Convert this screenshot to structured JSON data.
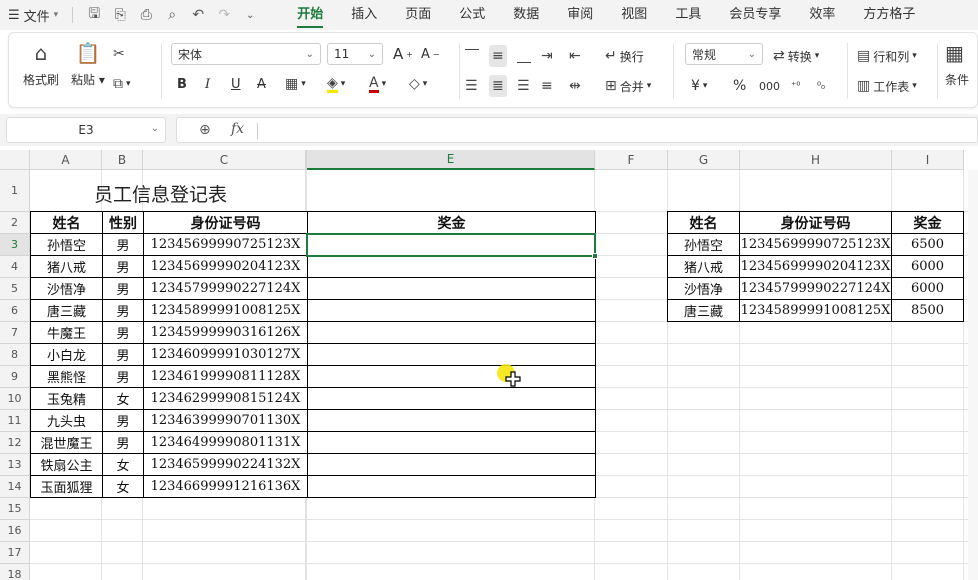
{
  "menubar": {
    "file_label": "文件",
    "tabs": [
      "开始",
      "插入",
      "页面",
      "公式",
      "数据",
      "审阅",
      "视图",
      "工具",
      "会员专享",
      "效率",
      "方方格子"
    ],
    "active_tab": 0
  },
  "ribbon": {
    "format_painter": "格式刷",
    "paste": "粘贴",
    "font_name": "宋体",
    "font_size": "11",
    "wrap": "换行",
    "merge": "合并",
    "number_format": "常规",
    "convert": "转换",
    "row_col": "行和列",
    "worksheet": "工作表",
    "conditional": "条件",
    "currency_symbol": "¥",
    "percent_symbol": "%",
    "bold": "B",
    "italic": "I",
    "underline": "U",
    "font_grow": "A",
    "font_shrink": "A"
  },
  "formula_bar": {
    "cell_ref": "E3",
    "fx_label": "fx",
    "formula": ""
  },
  "columns": [
    "A",
    "B",
    "C",
    "",
    "E",
    "F",
    "G",
    "H",
    "I"
  ],
  "selected_column": "E",
  "rows": [
    "1",
    "2",
    "3",
    "4",
    "5",
    "6",
    "7",
    "8",
    "9",
    "10",
    "11",
    "12",
    "13",
    "14",
    "15",
    "16",
    "17",
    "18"
  ],
  "selected_row": "3",
  "sheet_title": "员工信息登记表",
  "main_table": {
    "headers": [
      "姓名",
      "性别",
      "身份证号码",
      "奖金"
    ],
    "rows": [
      [
        "孙悟空",
        "男",
        "12345699990725123X",
        ""
      ],
      [
        "猪八戒",
        "男",
        "12345699990204123X",
        ""
      ],
      [
        "沙悟净",
        "男",
        "12345799990227124X",
        ""
      ],
      [
        "唐三藏",
        "男",
        "12345899991008125X",
        ""
      ],
      [
        "牛魔王",
        "男",
        "12345999990316126X",
        ""
      ],
      [
        "小白龙",
        "男",
        "12346099991030127X",
        ""
      ],
      [
        "黑熊怪",
        "男",
        "12346199990811128X",
        ""
      ],
      [
        "玉兔精",
        "女",
        "12346299990815124X",
        ""
      ],
      [
        "九头虫",
        "男",
        "12346399990701130X",
        ""
      ],
      [
        "混世魔王",
        "男",
        "12346499990801131X",
        ""
      ],
      [
        "铁扇公主",
        "女",
        "12346599990224132X",
        ""
      ],
      [
        "玉面狐狸",
        "女",
        "12346699991216136X",
        ""
      ]
    ]
  },
  "lookup_table": {
    "headers": [
      "姓名",
      "身份证号码",
      "奖金"
    ],
    "rows": [
      [
        "孙悟空",
        "12345699990725123X",
        "6500"
      ],
      [
        "猪八戒",
        "12345699990204123X",
        "6000"
      ],
      [
        "沙悟净",
        "12345799990227124X",
        "6000"
      ],
      [
        "唐三藏",
        "12345899991008125X",
        "8500"
      ]
    ]
  },
  "colors": {
    "accent": "#1e7b3b",
    "cursor_highlight": "#f5e600"
  }
}
